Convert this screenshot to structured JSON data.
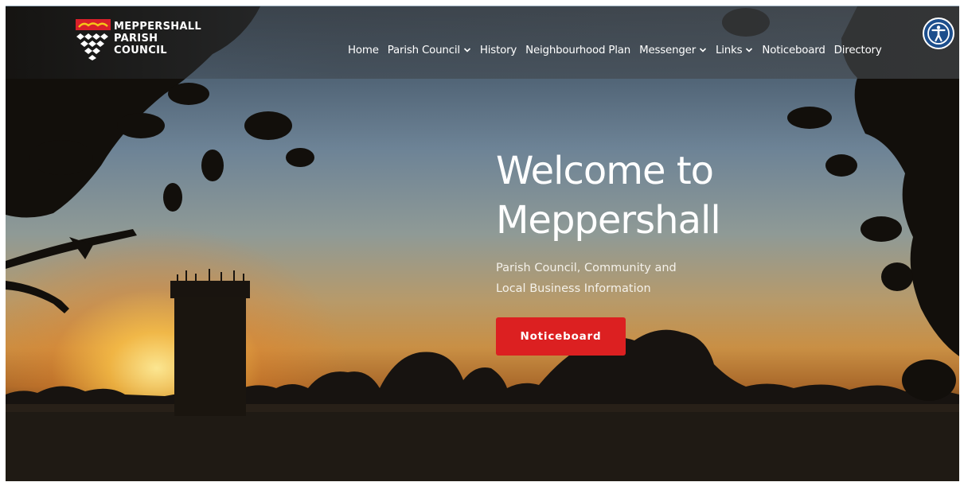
{
  "brand": {
    "name_line1": "MEPPERSHALL",
    "name_line2": "PARISH",
    "name_line3": "COUNCIL"
  },
  "nav": {
    "items": [
      {
        "label": "Home",
        "has_dropdown": false
      },
      {
        "label": "Parish Council",
        "has_dropdown": true
      },
      {
        "label": "History",
        "has_dropdown": false
      },
      {
        "label": "Neighbourhood Plan",
        "has_dropdown": false
      },
      {
        "label": "Messenger",
        "has_dropdown": true
      },
      {
        "label": "Links",
        "has_dropdown": true
      },
      {
        "label": "Noticeboard",
        "has_dropdown": false
      },
      {
        "label": "Directory",
        "has_dropdown": false
      }
    ]
  },
  "accessibility": {
    "icon": "accessibility-icon"
  },
  "hero": {
    "title_line1": "Welcome to",
    "title_line2": "Meppershall",
    "subtitle_line1": "Parish Council, Community and",
    "subtitle_line2": "Local Business Information",
    "cta_label": "Noticeboard"
  },
  "colors": {
    "cta": "#dc2021",
    "accessibility_button": "#1c4e8c",
    "nav_text": "#ffffff"
  }
}
